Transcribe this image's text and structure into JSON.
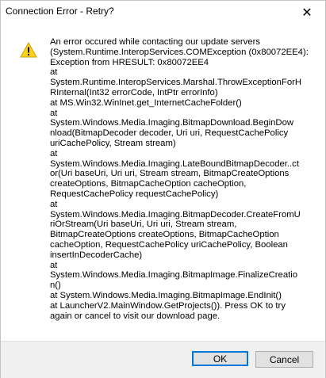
{
  "window": {
    "title": "Connection Error - Retry?",
    "close_glyph": "✕"
  },
  "icon": {
    "name": "warning-icon",
    "fill": "#fcd116",
    "stroke": "#c9a200"
  },
  "message_lines": [
    "An error occured while contacting our update servers",
    "(System.Runtime.InteropServices.COMException (0x80072EE4):",
    "Exception from HRESULT: 0x80072EE4",
    "   at",
    "System.Runtime.InteropServices.Marshal.ThrowExceptionForH",
    "RInternal(Int32 errorCode, IntPtr errorInfo)",
    "   at MS.Win32.WinInet.get_InternetCacheFolder()",
    "   at",
    "System.Windows.Media.Imaging.BitmapDownload.BeginDow",
    "nload(BitmapDecoder decoder, Uri uri, RequestCachePolicy",
    "uriCachePolicy, Stream stream)",
    "   at",
    "System.Windows.Media.Imaging.LateBoundBitmapDecoder..ct",
    "or(Uri baseUri, Uri uri, Stream stream, BitmapCreateOptions",
    "createOptions, BitmapCacheOption cacheOption,",
    "RequestCachePolicy requestCachePolicy)",
    "   at",
    "System.Windows.Media.Imaging.BitmapDecoder.CreateFromU",
    "riOrStream(Uri baseUri, Uri uri, Stream stream,",
    "BitmapCreateOptions createOptions, BitmapCacheOption",
    "cacheOption, RequestCachePolicy uriCachePolicy, Boolean",
    "insertInDecoderCache)",
    "   at",
    "System.Windows.Media.Imaging.BitmapImage.FinalizeCreatio",
    "n()",
    "   at System.Windows.Media.Imaging.BitmapImage.EndInit()",
    "   at LauncherV2.MainWindow.GetProjects()).  Press OK to try",
    "again or cancel to visit our download page."
  ],
  "buttons": {
    "ok_label": "OK",
    "cancel_label": "Cancel"
  },
  "colors": {
    "default_button_border": "#0078d7",
    "footer_background": "#f0f0f0"
  }
}
